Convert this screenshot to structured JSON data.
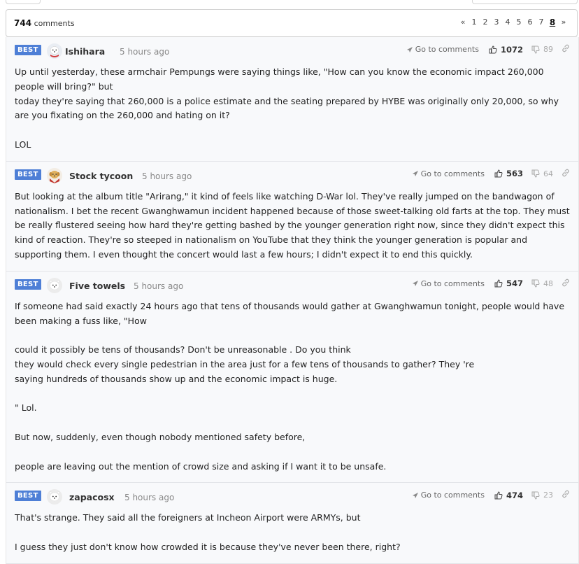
{
  "header": {
    "count_number": "744",
    "count_label": "comments",
    "pager": [
      "«",
      "1",
      "2",
      "3",
      "4",
      "5",
      "6",
      "7",
      "8",
      "»"
    ],
    "current_page": "8"
  },
  "labels": {
    "best_badge": "BEST",
    "go_to_comments": "Go to comments"
  },
  "colors": {
    "badge": "#4e7fd6",
    "comment_bg": "#f8f9fb"
  },
  "comments": [
    {
      "author": "Ishihara",
      "time": "5 hours ago",
      "likes": "1072",
      "dislikes": "89",
      "avatar_icon": "white-dog-red-collar-icon",
      "lines": [
        "Up until yesterday, these armchair Pempungs were saying things like, \"How can you know the economic impact 260,000 people will bring?\" but",
        "today they're saying that 260,000 is a police estimate and the seating prepared by HYBE was originally only 20,000, so why are you fixating on the 260,000 and hating on it?",
        "",
        "LOL"
      ]
    },
    {
      "author": "Stock tycoon",
      "time": "5 hours ago",
      "likes": "563",
      "dislikes": "64",
      "avatar_icon": "golden-dog-cape-icon",
      "lines": [
        "But looking at the album title \"Arirang,\" it kind of feels like watching D-War lol. They've really jumped on the bandwagon of nationalism. I bet the recent Gwanghwamun incident happened because of those sweet-talking old farts at the top. They must be really flustered seeing how hard they're getting bashed by the younger generation right now, since they didn't expect this kind of reaction. They're so steeped in nationalism on YouTube that they think the younger generation is popular and supporting them. I even thought the concert would last a few hours; I didn't expect it to end this quickly."
      ]
    },
    {
      "author": "Five towels",
      "time": "5 hours ago",
      "likes": "547",
      "dislikes": "48",
      "avatar_icon": "white-dog-icon",
      "lines": [
        "If someone had said exactly 24 hours ago that tens of thousands would gather at Gwanghwamun tonight, people would have been making a fuss like, \"How",
        "",
        "could it possibly be tens of thousands? Don't be unreasonable . Do you think",
        "they would check every single pedestrian in the area just for a few tens of thousands to gather? They 're",
        "saying hundreds of thousands show up and the economic impact is huge.",
        "",
        "\" Lol.",
        "",
        "But now, suddenly, even though nobody mentioned safety before,",
        "",
        "people are leaving out the mention of crowd size and asking if I want it to be unsafe."
      ]
    },
    {
      "author": "zapacosx",
      "time": "5 hours ago",
      "likes": "474",
      "dislikes": "23",
      "avatar_icon": "white-dog-icon",
      "lines": [
        "That's strange. They said all the foreigners at Incheon Airport were ARMYs, but",
        "",
        "I guess they just don't know how crowded it is because they've never been there, right?"
      ]
    }
  ]
}
